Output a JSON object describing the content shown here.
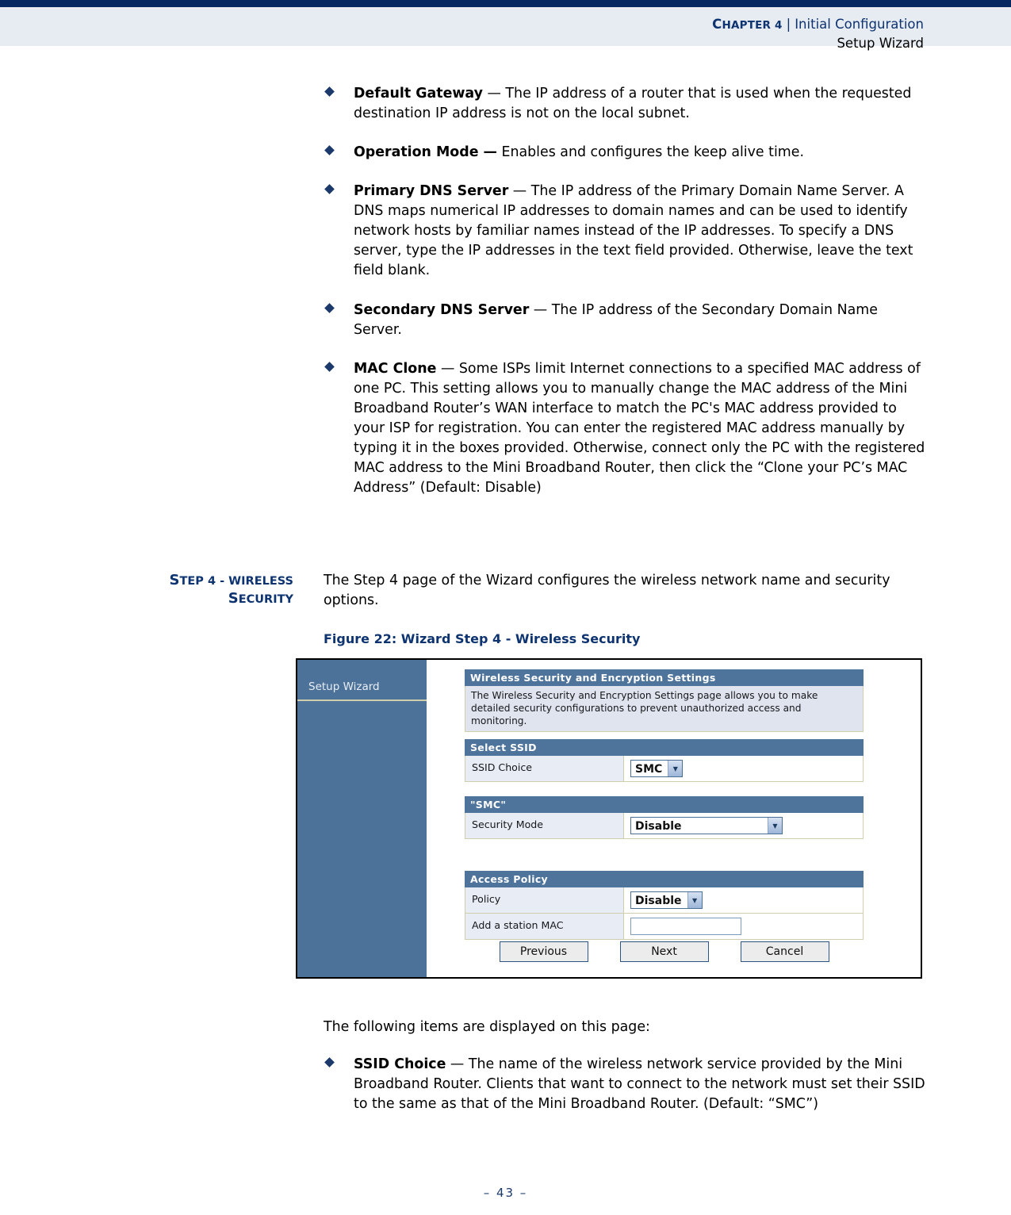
{
  "header": {
    "chapter_label": "Chapter 4",
    "chapter_small_caps": "HAPTER 4",
    "chapter_cap": "C",
    "separator": "|",
    "section": "Initial Configuration",
    "subsection": "Setup Wizard"
  },
  "bullets_top": [
    {
      "term": "Default Gateway",
      "dash": " — ",
      "text": "The IP address of a router that is used when the requested destination IP address is not on the local subnet."
    },
    {
      "term": "Operation Mode —",
      "dash": " ",
      "text": "Enables and configures the keep alive time."
    },
    {
      "term": "Primary DNS Server",
      "dash": " — ",
      "text": "The IP address of the Primary Domain Name Server. A DNS maps numerical IP addresses to domain names and can be used to identify network hosts by familiar names instead of the IP addresses. To specify a DNS server, type the IP addresses in the text field provided. Otherwise, leave the text field blank."
    },
    {
      "term": "Secondary DNS Server",
      "dash": " — ",
      "text": "The IP address of the Secondary Domain Name Server."
    },
    {
      "term": "MAC Clone",
      "dash": " — ",
      "text": "Some ISPs limit Internet connections to a specified MAC address of one PC. This setting allows you to manually change the MAC address of the Mini Broadband Router’s WAN interface to match the PC's MAC address provided to your ISP for registration. You can enter the registered MAC address manually by typing it in the boxes provided. Otherwise, connect only the PC with the registered MAC address to the Mini Broadband Router, then click the “Clone your PC’s MAC Address” (Default: Disable)"
    }
  ],
  "side_heading": {
    "line1_cap": "S",
    "line1_rest": "TEP 4 - W",
    "line1_rest2": "IRELESS",
    "line2_cap": "S",
    "line2_rest": "ECURITY",
    "full": "Step 4 - Wireless Security"
  },
  "intro_paragraph": "The Step 4 page of the Wizard configures the wireless network name and security options.",
  "figure_caption": "Figure 22:  Wizard Step 4 - Wireless Security",
  "figure": {
    "sidebar_label": "Setup Wizard",
    "panels": [
      {
        "title": "Wireless Security and Encryption Settings",
        "note": "The Wireless Security and Encryption Settings page allows you to make detailed security configurations to prevent unauthorized access and monitoring."
      },
      {
        "title": "Select SSID",
        "rows": [
          {
            "label": "SSID Choice",
            "control": "select",
            "value": "SMC"
          }
        ]
      },
      {
        "title": "\"SMC\"",
        "rows": [
          {
            "label": "Security Mode",
            "control": "select-wide",
            "value": "Disable"
          }
        ]
      },
      {
        "title": "Access Policy",
        "rows": [
          {
            "label": "Policy",
            "control": "select",
            "value": "Disable"
          },
          {
            "label": "Add a station MAC",
            "control": "textbox",
            "value": ""
          }
        ]
      }
    ],
    "buttons": [
      {
        "label": "Previous"
      },
      {
        "label": "Next"
      },
      {
        "label": "Cancel"
      }
    ]
  },
  "following_items_text": "The following items are displayed on this page:",
  "bullets_bottom": [
    {
      "term": "SSID Choice",
      "dash": " — ",
      "text": "The name of the wireless network service provided by the Mini Broadband Router. Clients that want to connect to the network must set their SSID to the same as that of the Mini Broadband Router. (Default: “SMC”)"
    }
  ],
  "footer": {
    "page_number": "–  43  –"
  },
  "colors": {
    "navy_rule": "#04285f",
    "header_band": "#e7ebf2",
    "heading_blue": "#0d3470",
    "panel_blue": "#4e749c",
    "sidebar_blue": "#4d729a",
    "label_cell": "#e8ecf4",
    "note_cell": "#dfe4ee"
  }
}
